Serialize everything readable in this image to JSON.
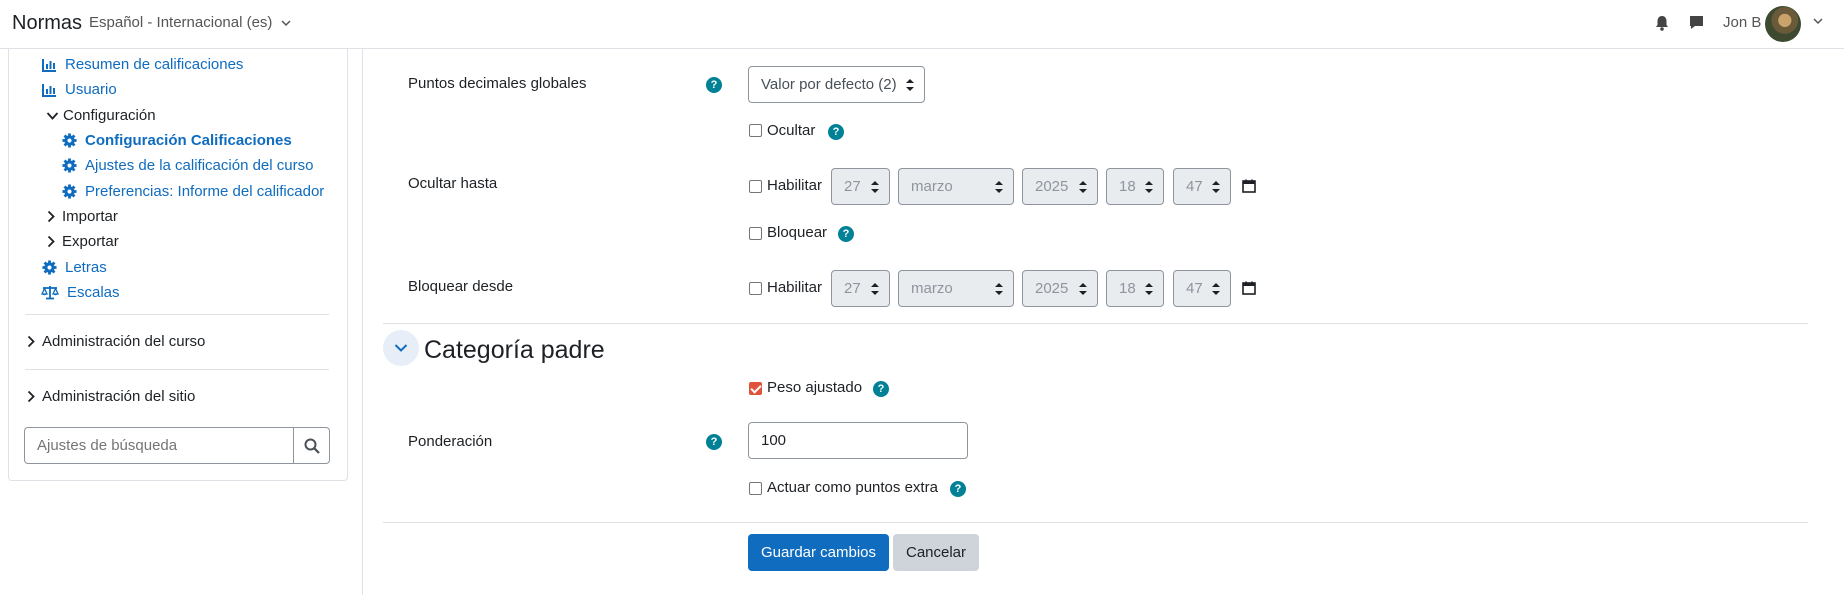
{
  "navbar": {
    "brand": "Normas",
    "language": "Español - Internacional (es)",
    "username": "Jon B"
  },
  "drawer": {
    "items": [
      {
        "label": "Resumen de calificaciones",
        "icon": "bar-chart-icon"
      },
      {
        "label": "Usuario",
        "icon": "bar-chart-icon"
      },
      {
        "label": "Configuración",
        "icon": "chevron-down-icon"
      },
      {
        "label": "Configuración Calificaciones",
        "icon": "gear-icon"
      },
      {
        "label": "Ajustes de la calificación del curso",
        "icon": "gear-icon"
      },
      {
        "label": "Preferencias: Informe del calificador",
        "icon": "gear-icon"
      },
      {
        "label": "Importar",
        "icon": "chevron-right-icon"
      },
      {
        "label": "Exportar",
        "icon": "chevron-right-icon"
      },
      {
        "label": "Letras",
        "icon": "gear-icon"
      },
      {
        "label": "Escalas",
        "icon": "balance-scale-icon"
      }
    ],
    "course_admin": "Administración del curso",
    "site_admin": "Administración del sitio",
    "search_placeholder": "Ajustes de búsqueda"
  },
  "form": {
    "decimal_label": "Puntos decimales globales",
    "decimal_value": "Valor por defecto (2)",
    "hide_label": "Ocultar",
    "hide_until_label": "Ocultar hasta",
    "enable_label": "Habilitar",
    "lock_label": "Bloquear",
    "lock_after_label": "Bloquear desde",
    "date": {
      "day": "27",
      "month": "marzo",
      "year": "2025",
      "hour": "18",
      "minute": "47"
    },
    "section_title": "Categoría padre",
    "weight_adjusted_label": "Peso ajustado",
    "weight_adjusted_checked": true,
    "weight_label": "Ponderación",
    "weight_value": "100",
    "extra_credit_label": "Actuar como puntos extra",
    "save_label": "Guardar cambios",
    "cancel_label": "Cancelar"
  },
  "colors": {
    "link": "#0f6cbf",
    "help": "#008196",
    "checkbox_checked": "#e0533b",
    "primary_button": "#0f6cbf"
  }
}
